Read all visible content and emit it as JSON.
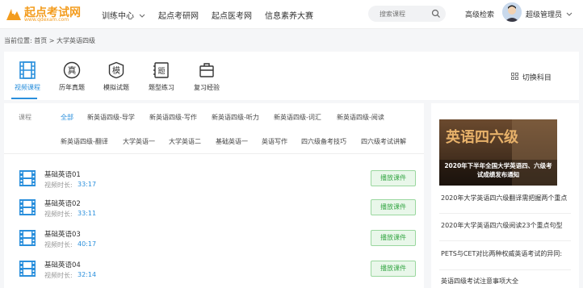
{
  "header": {
    "logo_text": "起点考试网",
    "logo_url": "www.qdexam.com",
    "nav": [
      "训练中心",
      "起点考研网",
      "起点医考网",
      "信息素养大赛"
    ],
    "search_placeholder": "搜索课程",
    "advanced_search": "高级检索",
    "username": "超级管理员"
  },
  "breadcrumb": "当前位置: 首页 > 大学英语四级",
  "tabs": [
    {
      "label": "视频课程",
      "icon": "film-icon",
      "active": true
    },
    {
      "label": "历年真题",
      "icon": "zhen-badge-icon"
    },
    {
      "label": "模拟试题",
      "icon": "mo-badge-icon"
    },
    {
      "label": "题型练习",
      "icon": "question-type-icon"
    },
    {
      "label": "复习经验",
      "icon": "briefcase-icon"
    }
  ],
  "switch_subject": "切换科目",
  "filters": {
    "label": "课程",
    "row1": [
      "全部",
      "新英语四级-导学",
      "新英语四级-写作",
      "新英语四级-听力",
      "新英语四级-词汇",
      "新英语四级-阅读"
    ],
    "row2": [
      "新英语四级-翻译",
      "大学英语一",
      "大学英语二",
      "基础英语一",
      "英语写作",
      "四六级备考技巧",
      "四六级考试讲解"
    ]
  },
  "duration_label": "视频时长:",
  "play_label": "播放课件",
  "courses": [
    {
      "title": "基础英语01",
      "duration": "33:17"
    },
    {
      "title": "基础英语02",
      "duration": "33:11"
    },
    {
      "title": "基础英语03",
      "duration": "40:17"
    },
    {
      "title": "基础英语04",
      "duration": "32:14"
    }
  ],
  "news": {
    "banner_headline": "英语四六级",
    "banner_caption": "2020年下半年全国大学英语四、六级考试成绩发布通知",
    "items": [
      "2020年大学英语四六级翻译需把握两个重点",
      "2020年大学英语四六级阅读23个重点句型",
      "PETS与CET对比两种权威英语考试的异同:",
      "英语四级考试注意事项大全"
    ]
  },
  "colors": {
    "accent": "#2a8fdc",
    "play_green": "#39a848",
    "logo_orange": "#f39c1e"
  }
}
